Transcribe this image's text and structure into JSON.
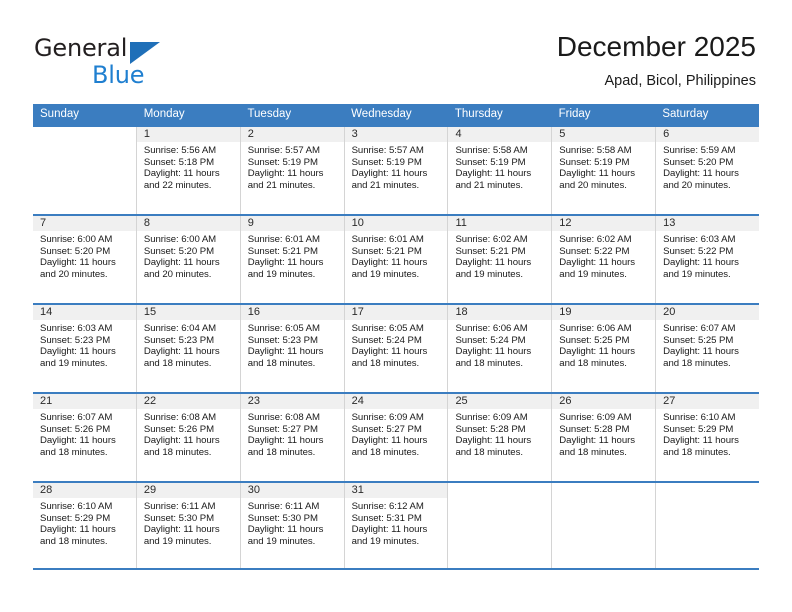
{
  "brand": {
    "name_part1": "General",
    "name_part2": "Blue",
    "triangle_color": "#1f6fb8",
    "blue_color": "#1f7fd0"
  },
  "header": {
    "title": "December 2025",
    "subtitle": "Apad, Bicol, Philippines"
  },
  "theme": {
    "header_blue": "#3b7dc0",
    "day_strip_gray": "#f0f0f0",
    "cell_border": "#d4d4d4"
  },
  "weekdays": [
    "Sunday",
    "Monday",
    "Tuesday",
    "Wednesday",
    "Thursday",
    "Friday",
    "Saturday"
  ],
  "weeks": [
    [
      {
        "day": "",
        "sunrise": "",
        "sunset": "",
        "daylight": "",
        "empty": true
      },
      {
        "day": "1",
        "sunrise": "Sunrise: 5:56 AM",
        "sunset": "Sunset: 5:18 PM",
        "daylight": "Daylight: 11 hours and 22 minutes."
      },
      {
        "day": "2",
        "sunrise": "Sunrise: 5:57 AM",
        "sunset": "Sunset: 5:19 PM",
        "daylight": "Daylight: 11 hours and 21 minutes."
      },
      {
        "day": "3",
        "sunrise": "Sunrise: 5:57 AM",
        "sunset": "Sunset: 5:19 PM",
        "daylight": "Daylight: 11 hours and 21 minutes."
      },
      {
        "day": "4",
        "sunrise": "Sunrise: 5:58 AM",
        "sunset": "Sunset: 5:19 PM",
        "daylight": "Daylight: 11 hours and 21 minutes."
      },
      {
        "day": "5",
        "sunrise": "Sunrise: 5:58 AM",
        "sunset": "Sunset: 5:19 PM",
        "daylight": "Daylight: 11 hours and 20 minutes."
      },
      {
        "day": "6",
        "sunrise": "Sunrise: 5:59 AM",
        "sunset": "Sunset: 5:20 PM",
        "daylight": "Daylight: 11 hours and 20 minutes."
      }
    ],
    [
      {
        "day": "7",
        "sunrise": "Sunrise: 6:00 AM",
        "sunset": "Sunset: 5:20 PM",
        "daylight": "Daylight: 11 hours and 20 minutes."
      },
      {
        "day": "8",
        "sunrise": "Sunrise: 6:00 AM",
        "sunset": "Sunset: 5:20 PM",
        "daylight": "Daylight: 11 hours and 20 minutes."
      },
      {
        "day": "9",
        "sunrise": "Sunrise: 6:01 AM",
        "sunset": "Sunset: 5:21 PM",
        "daylight": "Daylight: 11 hours and 19 minutes."
      },
      {
        "day": "10",
        "sunrise": "Sunrise: 6:01 AM",
        "sunset": "Sunset: 5:21 PM",
        "daylight": "Daylight: 11 hours and 19 minutes."
      },
      {
        "day": "11",
        "sunrise": "Sunrise: 6:02 AM",
        "sunset": "Sunset: 5:21 PM",
        "daylight": "Daylight: 11 hours and 19 minutes."
      },
      {
        "day": "12",
        "sunrise": "Sunrise: 6:02 AM",
        "sunset": "Sunset: 5:22 PM",
        "daylight": "Daylight: 11 hours and 19 minutes."
      },
      {
        "day": "13",
        "sunrise": "Sunrise: 6:03 AM",
        "sunset": "Sunset: 5:22 PM",
        "daylight": "Daylight: 11 hours and 19 minutes."
      }
    ],
    [
      {
        "day": "14",
        "sunrise": "Sunrise: 6:03 AM",
        "sunset": "Sunset: 5:23 PM",
        "daylight": "Daylight: 11 hours and 19 minutes."
      },
      {
        "day": "15",
        "sunrise": "Sunrise: 6:04 AM",
        "sunset": "Sunset: 5:23 PM",
        "daylight": "Daylight: 11 hours and 18 minutes."
      },
      {
        "day": "16",
        "sunrise": "Sunrise: 6:05 AM",
        "sunset": "Sunset: 5:23 PM",
        "daylight": "Daylight: 11 hours and 18 minutes."
      },
      {
        "day": "17",
        "sunrise": "Sunrise: 6:05 AM",
        "sunset": "Sunset: 5:24 PM",
        "daylight": "Daylight: 11 hours and 18 minutes."
      },
      {
        "day": "18",
        "sunrise": "Sunrise: 6:06 AM",
        "sunset": "Sunset: 5:24 PM",
        "daylight": "Daylight: 11 hours and 18 minutes."
      },
      {
        "day": "19",
        "sunrise": "Sunrise: 6:06 AM",
        "sunset": "Sunset: 5:25 PM",
        "daylight": "Daylight: 11 hours and 18 minutes."
      },
      {
        "day": "20",
        "sunrise": "Sunrise: 6:07 AM",
        "sunset": "Sunset: 5:25 PM",
        "daylight": "Daylight: 11 hours and 18 minutes."
      }
    ],
    [
      {
        "day": "21",
        "sunrise": "Sunrise: 6:07 AM",
        "sunset": "Sunset: 5:26 PM",
        "daylight": "Daylight: 11 hours and 18 minutes."
      },
      {
        "day": "22",
        "sunrise": "Sunrise: 6:08 AM",
        "sunset": "Sunset: 5:26 PM",
        "daylight": "Daylight: 11 hours and 18 minutes."
      },
      {
        "day": "23",
        "sunrise": "Sunrise: 6:08 AM",
        "sunset": "Sunset: 5:27 PM",
        "daylight": "Daylight: 11 hours and 18 minutes."
      },
      {
        "day": "24",
        "sunrise": "Sunrise: 6:09 AM",
        "sunset": "Sunset: 5:27 PM",
        "daylight": "Daylight: 11 hours and 18 minutes."
      },
      {
        "day": "25",
        "sunrise": "Sunrise: 6:09 AM",
        "sunset": "Sunset: 5:28 PM",
        "daylight": "Daylight: 11 hours and 18 minutes."
      },
      {
        "day": "26",
        "sunrise": "Sunrise: 6:09 AM",
        "sunset": "Sunset: 5:28 PM",
        "daylight": "Daylight: 11 hours and 18 minutes."
      },
      {
        "day": "27",
        "sunrise": "Sunrise: 6:10 AM",
        "sunset": "Sunset: 5:29 PM",
        "daylight": "Daylight: 11 hours and 18 minutes."
      }
    ],
    [
      {
        "day": "28",
        "sunrise": "Sunrise: 6:10 AM",
        "sunset": "Sunset: 5:29 PM",
        "daylight": "Daylight: 11 hours and 18 minutes."
      },
      {
        "day": "29",
        "sunrise": "Sunrise: 6:11 AM",
        "sunset": "Sunset: 5:30 PM",
        "daylight": "Daylight: 11 hours and 19 minutes."
      },
      {
        "day": "30",
        "sunrise": "Sunrise: 6:11 AM",
        "sunset": "Sunset: 5:30 PM",
        "daylight": "Daylight: 11 hours and 19 minutes."
      },
      {
        "day": "31",
        "sunrise": "Sunrise: 6:12 AM",
        "sunset": "Sunset: 5:31 PM",
        "daylight": "Daylight: 11 hours and 19 minutes."
      },
      {
        "day": "",
        "sunrise": "",
        "sunset": "",
        "daylight": "",
        "empty": true
      },
      {
        "day": "",
        "sunrise": "",
        "sunset": "",
        "daylight": "",
        "empty": true
      },
      {
        "day": "",
        "sunrise": "",
        "sunset": "",
        "daylight": "",
        "empty": true
      }
    ]
  ]
}
